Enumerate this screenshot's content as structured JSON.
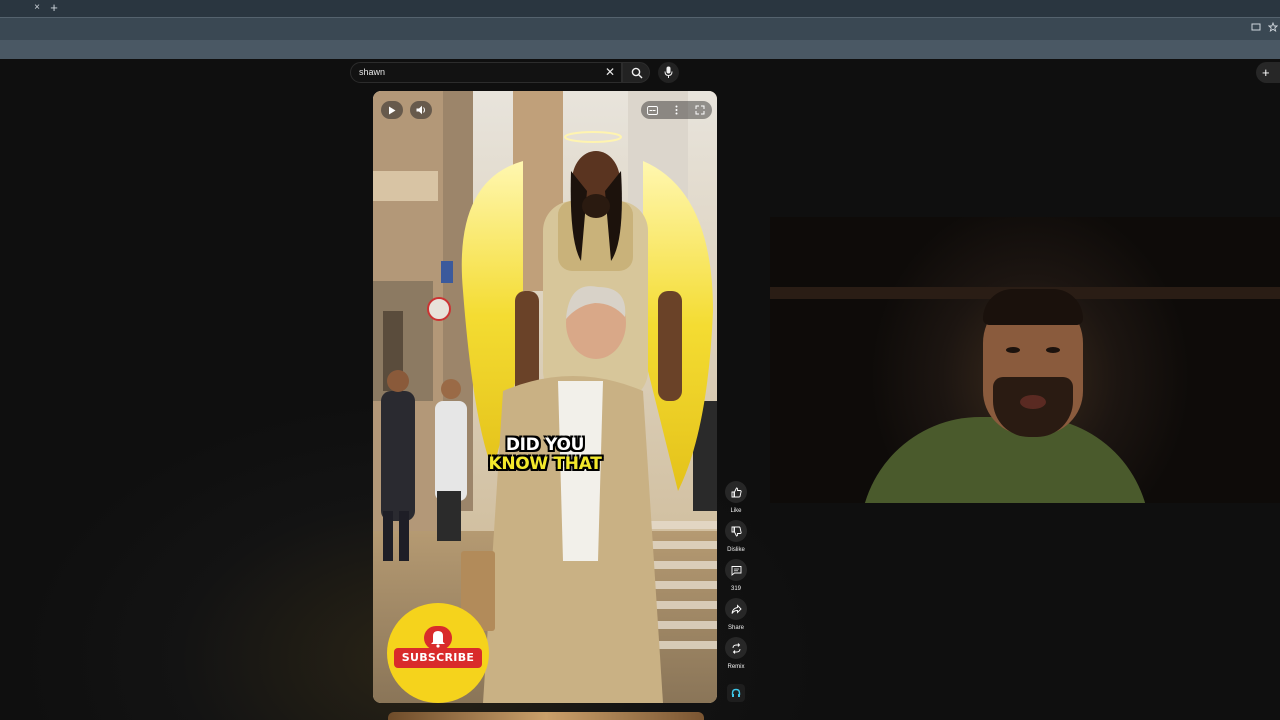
{
  "browser": {
    "tab_close": "×",
    "new_tab": "+"
  },
  "search": {
    "query": "shawn",
    "clear_glyph": "✕",
    "icon": "search-icon",
    "mic_icon": "microphone-icon"
  },
  "header": {
    "create_glyph": "+"
  },
  "short": {
    "caption_line1": "DID YOU",
    "caption_line2": "KNOW THAT",
    "caption_line2_color": "#f3e92c",
    "subscribe_label": "SUBSCRIBE",
    "subscribe_badge_color": "#f5d31c",
    "controls": [
      "play-icon",
      "volume-icon",
      "captions-icon",
      "more-icon",
      "fullscreen-icon"
    ]
  },
  "actions": [
    {
      "icon": "thumbs-up-icon",
      "label": "Like"
    },
    {
      "icon": "thumbs-down-icon",
      "label": "Dislike"
    },
    {
      "icon": "comment-icon",
      "label": "319"
    },
    {
      "icon": "share-icon",
      "label": "Share"
    },
    {
      "icon": "remix-icon",
      "label": "Remix"
    }
  ],
  "colors": {
    "page_bg": "#0f0f0f",
    "tabbar_bg": "#2a3640",
    "toolbar_bg": "#3a4853",
    "action_bg": "#272727"
  }
}
